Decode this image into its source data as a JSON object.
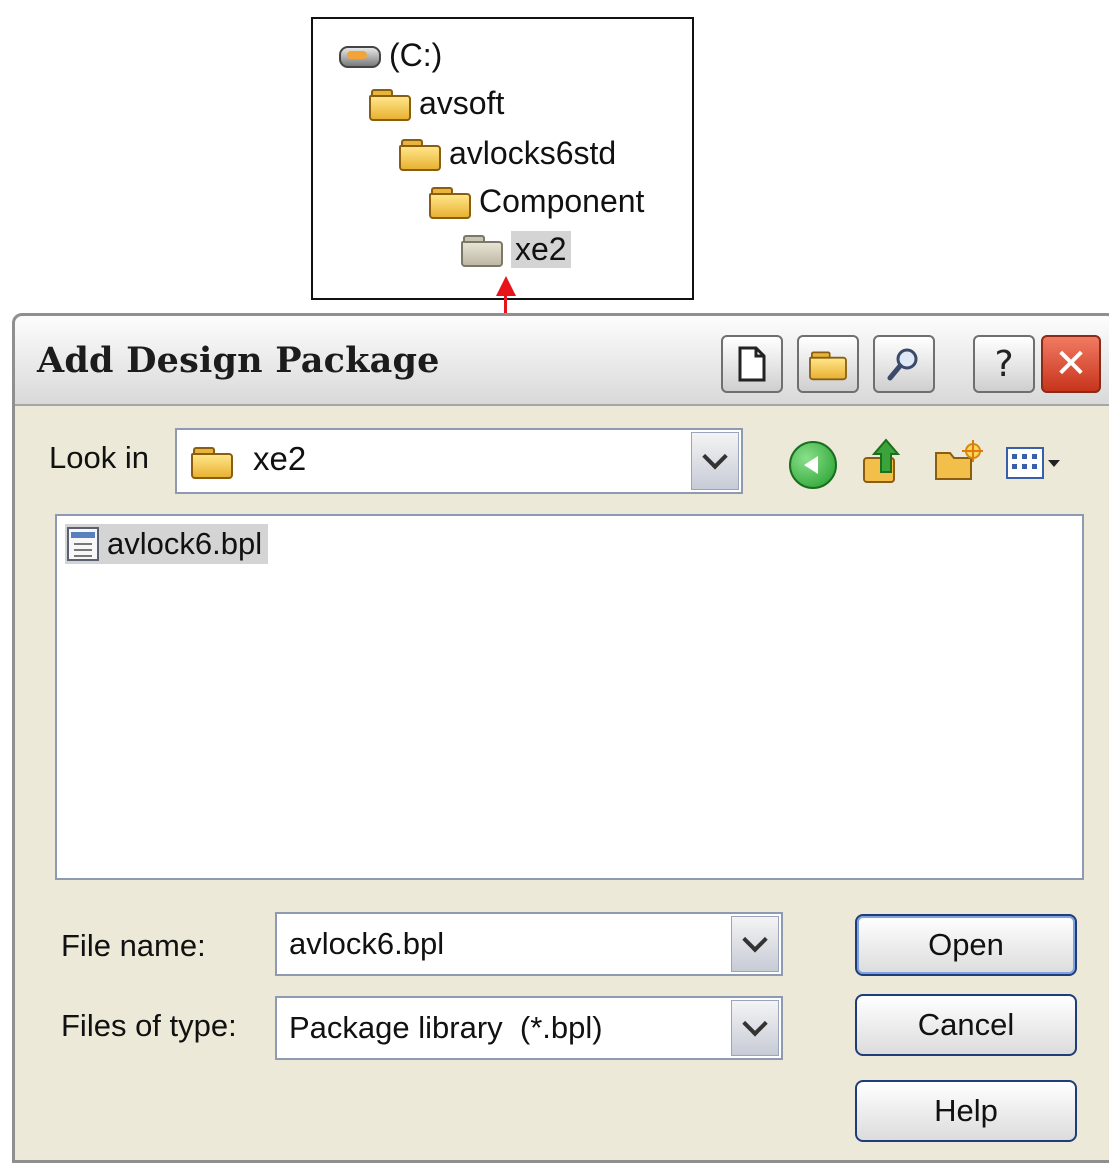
{
  "tree": {
    "items": [
      {
        "label": "(C:)",
        "icon": "drive-icon"
      },
      {
        "label": "avsoft",
        "icon": "folder-icon"
      },
      {
        "label": "avlocks6std",
        "icon": "folder-icon"
      },
      {
        "label": "Component",
        "icon": "folder-icon"
      },
      {
        "label": "xe2",
        "icon": "folder-icon",
        "selected": true
      }
    ]
  },
  "dialog": {
    "title": "Add Design Package",
    "look_in_label": "Look in",
    "look_in_value": "xe2",
    "files": [
      {
        "name": "avlock6.bpl",
        "selected": true
      }
    ],
    "file_name_label": "File name:",
    "file_name_value": "avlock6.bpl",
    "file_type_label": "Files of type:",
    "file_type_value": "Package library  (*.bpl)",
    "buttons": {
      "open": "Open",
      "cancel": "Cancel",
      "help": "Help"
    },
    "help_glyph": "?",
    "close_glyph": "✕"
  },
  "colors": {
    "arrow": "#e8141c",
    "dialog_bg": "#ece9d8",
    "selection": "#d4d4d4",
    "close_button": "#c8341c"
  }
}
